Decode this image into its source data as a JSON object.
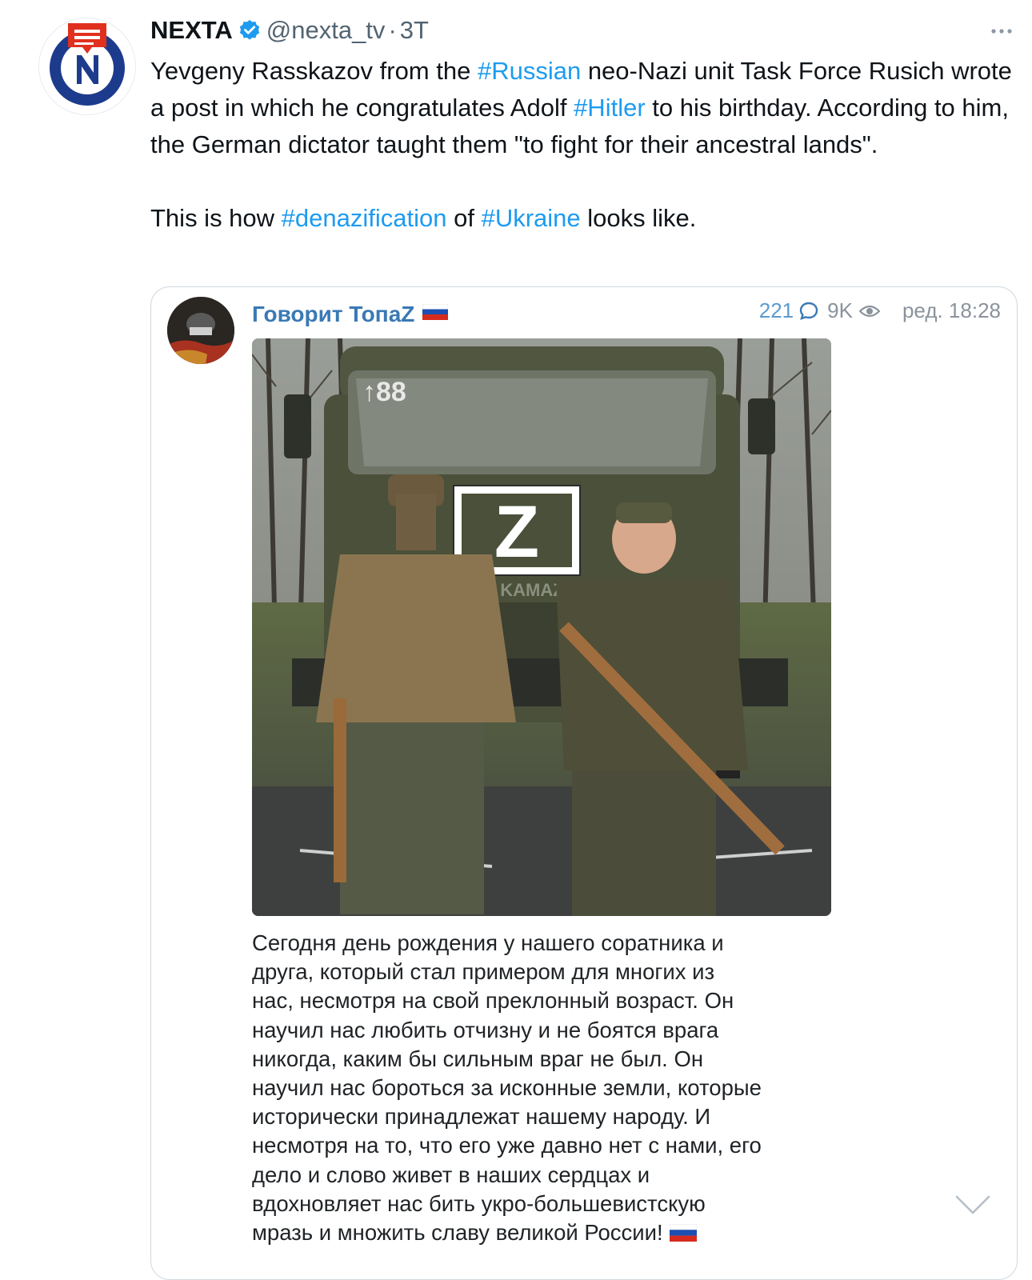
{
  "tweet": {
    "author_name": "NEXTA",
    "handle": "@nexta_tv",
    "separator": "·",
    "time": "3T",
    "verified": true,
    "body": {
      "p1": [
        {
          "text": "Yevgeny Rasskazov from the "
        },
        {
          "text": "#Russian",
          "hashtag": true
        },
        {
          "text": " neo-Nazi unit Task Force Rusich wrote a post in which he congratulates Adolf "
        },
        {
          "text": "#Hitler",
          "hashtag": true
        },
        {
          "text": " to his birthday. According to him, the German dictator taught them \"to fight for their ancestral lands\"."
        }
      ],
      "p2": [
        {
          "text": "This is how "
        },
        {
          "text": "#denazification",
          "hashtag": true
        },
        {
          "text": " of "
        },
        {
          "text": "#Ukraine",
          "hashtag": true
        },
        {
          "text": " looks like."
        }
      ]
    }
  },
  "quoted_post": {
    "channel_name": "Говорит ТопаZ",
    "comments": "221",
    "views": "9K",
    "edited_label": "ред. 18:28",
    "photo_text": {
      "windshield": "↑88",
      "letter": "Z",
      "brand": "KAMAZ"
    },
    "caption_lines": [
      "Сегодня день рождения у нашего соратника и",
      "друга, который стал примером для многих из",
      "нас, несмотря на свой преклонный возраст. Он",
      "научил нас любить отчизну и не боятся врага",
      "никогда, каким бы сильным враг не был. Он",
      "научил нас бороться за исконные земли, которые",
      "исторически принадлежат нашему народу. И",
      "несмотря на то, что его уже давно нет с нами, его",
      "дело и слово живет в наших сердцах и",
      "вдохновляет нас бить укро-большевистскую",
      "мразь и множить славу великой России!"
    ]
  },
  "icons": {
    "verified": "verified-badge-icon",
    "more": "more-options-icon",
    "comment": "comment-bubble-icon",
    "views": "eye-icon",
    "flag": "russian-flag-icon",
    "expand": "chevron-down-icon"
  },
  "colors": {
    "hashtag": "#1d9bf0",
    "channel_name": "#3a79b5",
    "views_count": "#5b9bd0",
    "meta": "#536471",
    "nexta_blue": "#1d3b8c",
    "nexta_red": "#e0301e"
  }
}
